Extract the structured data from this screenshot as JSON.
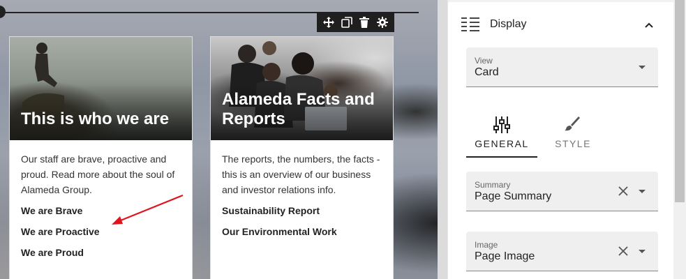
{
  "toolbar": {
    "move_icon": "move-icon",
    "copy_icon": "copy-icon",
    "delete_icon": "trash-icon",
    "settings_icon": "gear-icon"
  },
  "cards": [
    {
      "title": "This is who we are",
      "description": "Our staff are brave, proactive and proud. Read more about the soul of Alameda Group.",
      "links": [
        "We are Brave",
        "We are Proactive",
        "We are Proud"
      ]
    },
    {
      "title": "Alameda Facts and Reports",
      "description": "The reports, the numbers, the facts - this is an overview of our business and investor relations info.",
      "links": [
        "Sustainability Report",
        "Our Environmental Work"
      ]
    }
  ],
  "panel": {
    "section_title": "Display",
    "view": {
      "label": "View",
      "value": "Card"
    },
    "tabs": [
      {
        "label": "GENERAL",
        "icon": "sliders-icon",
        "active": true
      },
      {
        "label": "STYLE",
        "icon": "brush-icon",
        "active": false
      }
    ],
    "summary": {
      "label": "Summary",
      "value": "Page Summary"
    },
    "image": {
      "label": "Image",
      "value": "Page Image"
    }
  },
  "colors": {
    "annotation_arrow": "#e0141e",
    "toolbar_bg": "#1f1f1f",
    "field_bg": "#efefef"
  }
}
